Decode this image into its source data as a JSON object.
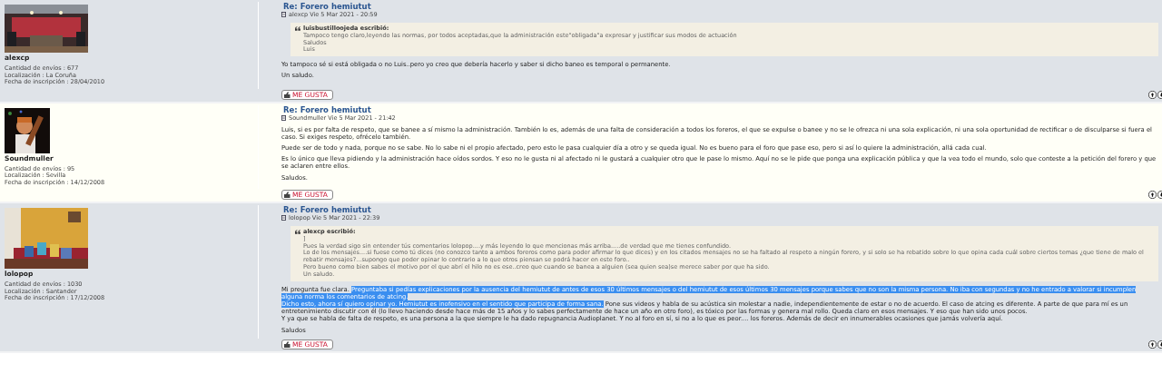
{
  "posts": [
    {
      "author": "alexcp",
      "stats": [
        "Cantidad de envíos : 677",
        "Localización : La Coruña",
        "Fecha de inscripción : 28/04/2010"
      ],
      "title": "Re: Forero hemiutut",
      "meta": "alexcp Vie 5 Mar 2021 - 20:59",
      "quote": {
        "author_line": "luisbustilloojeda escribió:",
        "lines": [
          "Tampoco  tengo  claro,leyendo  las normas, por todos aceptadas,que la administración  este\"obligada\"a expresar y justificar sus modos  de actuación",
          "Saludos",
          "Luis"
        ]
      },
      "paragraphs": [
        [
          [
            {
              "text": "Yo tampoco sé si está obligada o no Luis..pero yo creo que debería hacerlo y saber si dicho baneo es temporal o permanente.",
              "selected": false
            }
          ]
        ],
        [
          [
            {
              "text": "Un saludo.",
              "selected": false
            }
          ]
        ]
      ],
      "like": "ME GUSTA"
    },
    {
      "author": "Soundmuller",
      "stats": [
        "Cantidad de envíos : 95",
        "Localización : Sevilla",
        "Fecha de inscripción : 14/12/2008"
      ],
      "title": "Re: Forero hemiutut",
      "meta": "Soundmuller Vie 5 Mar 2021 - 21:42",
      "paragraphs": [
        [
          [
            {
              "text": "Luis, si es por falta de respeto, que se banee a sí mismo la administración. También lo es, además de una falta de consideración a todos los foreros, el que se expulse o banee y no se le ofrezca ni una sola explicación, ni una sola oportunidad de rectificar o de disculparse si fuera el caso. Si exiges respeto, ofrécelo también.",
              "selected": false
            }
          ]
        ],
        [
          [
            {
              "text": "Puede ser de todo y nada, porque no se sabe. No lo sabe ni el propio afectado, pero esto le pasa cualquier día a otro y se queda igual. No es bueno para el foro que pase eso, pero si así lo quiere la administración, allá cada cual.",
              "selected": false
            }
          ]
        ],
        [
          [
            {
              "text": "Es lo único que lleva pidiendo y la administración hace oídos sordos. Y eso no le gusta ni al afectado ni le gustará a cualquier otro que le pase lo mismo. Aquí no se le pide que ponga una explicación pública y que la vea todo el mundo, solo que conteste a la petición del forero y que se aclaren entre ellos.",
              "selected": false
            }
          ]
        ],
        [
          [
            {
              "text": "Saludos.",
              "selected": false
            }
          ]
        ]
      ],
      "like": "ME GUSTA"
    },
    {
      "author": "lolopop",
      "stats": [
        "Cantidad de envíos : 1030",
        "Localización : Santander",
        "Fecha de inscripción : 17/12/2008"
      ],
      "title": "Re: Forero hemiutut",
      "meta": "lolopop Vie 5 Mar 2021 - 22:39",
      "quote": {
        "author_line": "alexcp escribió:",
        "lines": [
          "]",
          "Pues la verdad sigo sin entender tús comentarios lolopop....y más leyendo lo que mencionas más arriba.....de verdad que me tienes confundido.",
          "Lo de los mensajes....si fuese como tú dices (no conozco tanto a ambos foreros como para poder afirmar lo que dices) y en los citados mensajes no se ha faltado al respeto a ningún forero, y si solo se ha rebatido sobre lo que opina cada cuál sobre ciertos temas ¿que tiene de malo el rebatir mensajes?...supongo que poder opinar lo contrario a lo que otros piensan se podrá hacer en este foro..",
          "Pero bueno como bien sabes el motivo por el que abrí el hilo no es ese..creo que cuando se banea a alguien (sea quien sea)se merece saber por que ha sido.",
          "Un saludo."
        ]
      },
      "paragraphs": [
        [
          [
            {
              "text": "Mi pregunta fue clara. ",
              "selected": false
            },
            {
              "text": "Preguntaba si pedías explicaciones por la ausencia del hemiutut de antes de esos 30 últimos mensajes o del hemiutut de esos últimos 30 mensajes porque sabes que no son la misma persona. No iba con segundas y no he entrado a valorar si incumplen alguna norma los comentarios de atcing.",
              "selected": true
            }
          ],
          [
            {
              "text": "Dicho esto, ahora sí quiero opinar yo. Hemiutut es inofensivo en el sentido que participa de forma sana.",
              "selected": true
            },
            {
              "text": " Pone sus videos y habla de su acústica sin molestar a nadie, independientemente de estar o no de acuerdo. El caso de atcing es diferente. A parte de que para mí es un entretenimiento discutir con él (lo llevo haciendo desde hace más de 15 años y lo sabes perfectamente de hace un año en otro foro), es tóxico por las formas y genera mal rollo. Queda claro en esos mensajes. Y eso que han sido unos pocos.",
              "selected": false
            }
          ],
          [
            {
              "text": "Y ya que se habla de falta de respeto, es una persona a la que siempre le ha dado repugnancia Audioplanet. Y no al foro en sí, si no a lo que es peor.... los foreros. Además de decir en innumerables ocasiones que jamás volvería aquí.",
              "selected": false
            }
          ]
        ],
        [
          [
            {
              "text": "Saludos",
              "selected": false
            }
          ]
        ]
      ],
      "like": "ME GUSTA"
    }
  ]
}
